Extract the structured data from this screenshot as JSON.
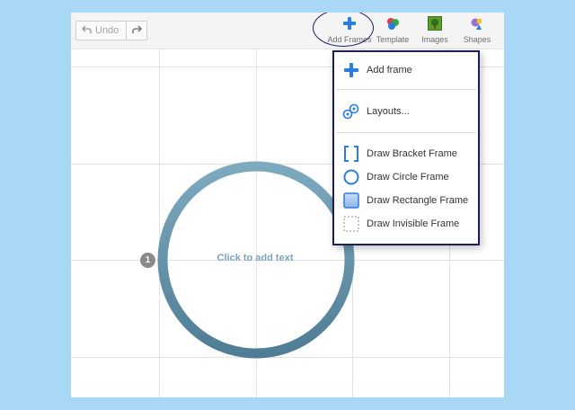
{
  "toolbar": {
    "undo_label": "Undo",
    "tools": [
      {
        "label": "Add Frames",
        "icon": "plus-icon"
      },
      {
        "label": "Template",
        "icon": "template-icon"
      },
      {
        "label": "Images",
        "icon": "image-icon"
      },
      {
        "label": "Shapes",
        "icon": "shapes-icon"
      }
    ]
  },
  "canvas": {
    "frame_placeholder": "Click to add text",
    "frame_number": "1",
    "frame_color": "#5e8fa8"
  },
  "menu": {
    "items": [
      {
        "label": "Add frame",
        "icon": "plus-icon"
      },
      {
        "label": "Layouts...",
        "icon": "layouts-icon"
      },
      {
        "label": "Draw Bracket Frame",
        "icon": "bracket-frame-icon"
      },
      {
        "label": "Draw Circle Frame",
        "icon": "circle-frame-icon"
      },
      {
        "label": "Draw Rectangle Frame",
        "icon": "rectangle-frame-icon"
      },
      {
        "label": "Draw Invisible Frame",
        "icon": "invisible-frame-icon"
      }
    ]
  },
  "colors": {
    "page_background": "#a8d8f5",
    "accent_blue": "#2a7de1",
    "menu_border": "#1a1f54"
  }
}
